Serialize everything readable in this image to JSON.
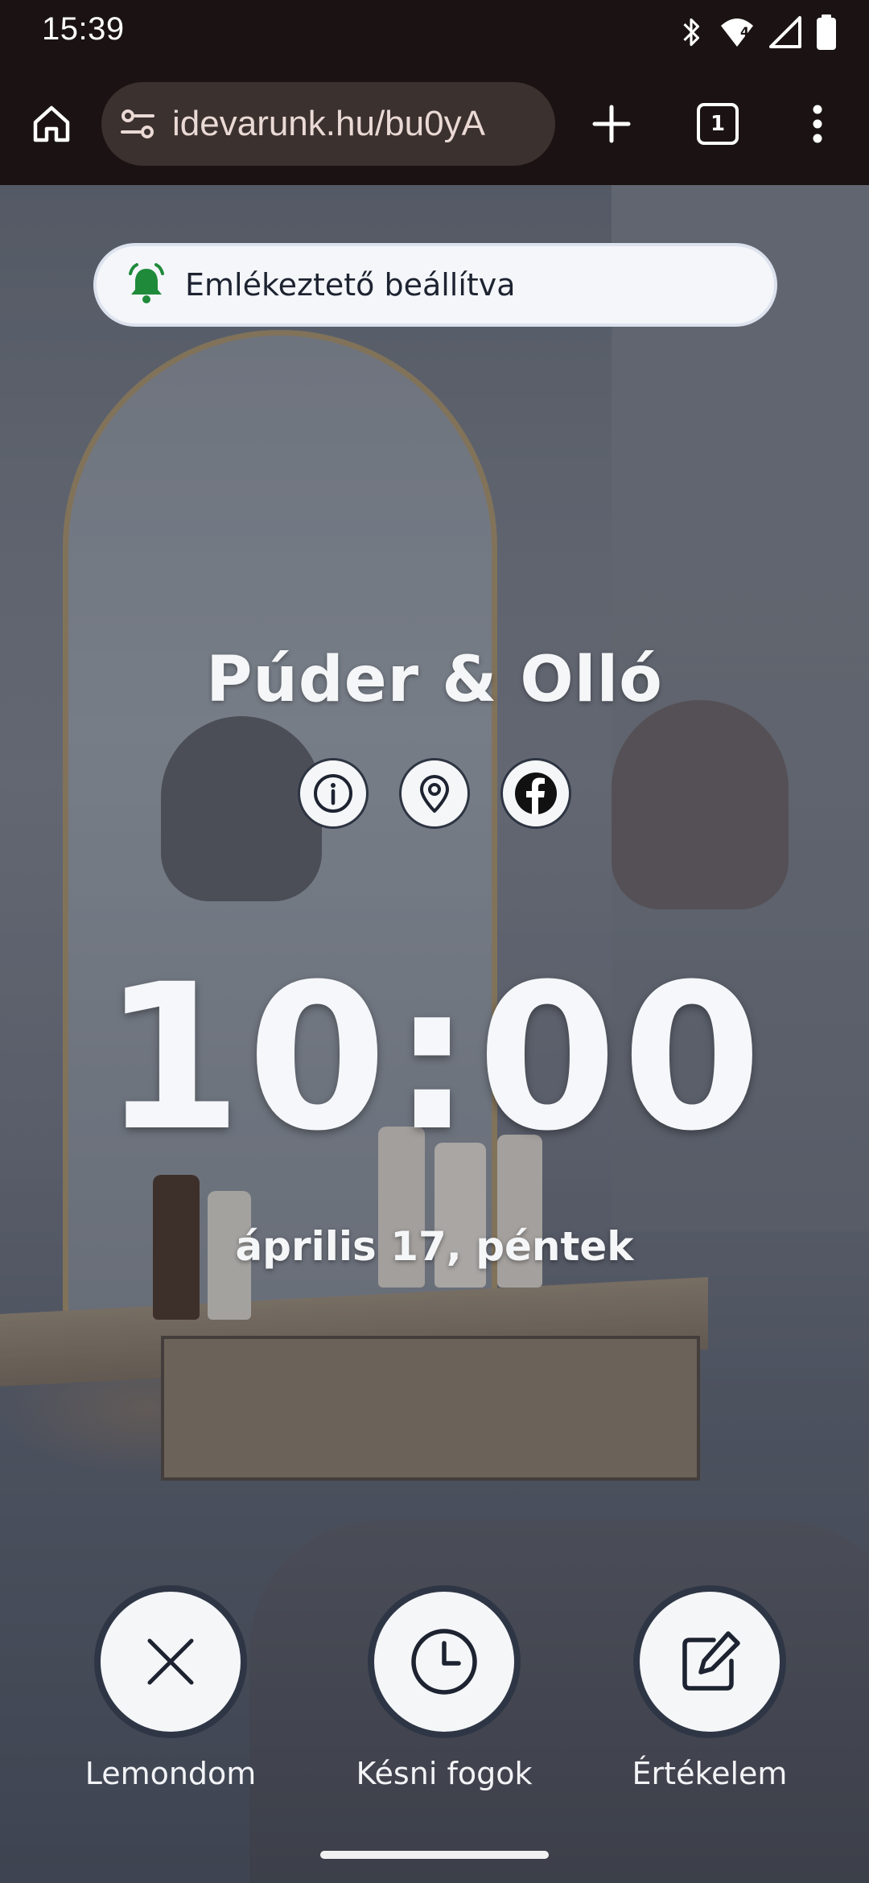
{
  "status_bar": {
    "time": "15:39",
    "wifi_badge": "4"
  },
  "browser": {
    "url": "idevarunk.hu/bu0yA",
    "tab_count": "1"
  },
  "reminder": {
    "text": "Emlékeztető beállítva",
    "icon": "bell-icon",
    "icon_color": "#1f8a3a"
  },
  "salon": {
    "name": "Púder & Olló"
  },
  "social_links": [
    {
      "icon": "info-icon"
    },
    {
      "icon": "location-pin-icon"
    },
    {
      "icon": "facebook-icon"
    }
  ],
  "appointment": {
    "time": "10:00",
    "date": "április 17, péntek"
  },
  "actions": [
    {
      "label": "Lemondom",
      "icon": "close-icon"
    },
    {
      "label": "Késni fogok",
      "icon": "clock-icon"
    },
    {
      "label": "Értékelem",
      "icon": "edit-icon"
    }
  ]
}
